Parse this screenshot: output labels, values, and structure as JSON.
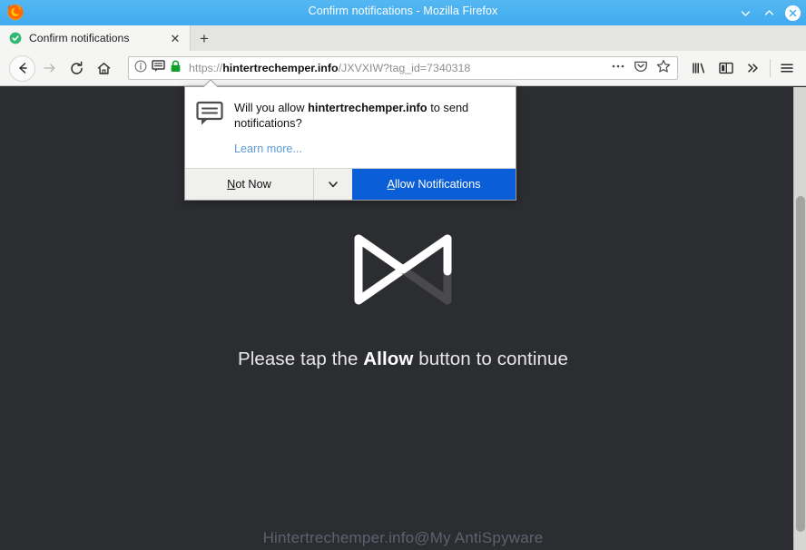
{
  "window": {
    "title": "Confirm notifications - Mozilla Firefox",
    "minimize_label": "⌄",
    "maximize_label": "⌃",
    "close_label": "✕"
  },
  "tabs": {
    "items": [
      {
        "label": "Confirm notifications",
        "favicon": "shield-check-icon",
        "close_label": "✕"
      }
    ],
    "new_tab_label": "+"
  },
  "navbar": {
    "back_icon": "back-arrow-icon",
    "forward_icon": "forward-arrow-icon",
    "reload_icon": "reload-icon",
    "home_icon": "home-icon",
    "url": {
      "scheme": "https://",
      "host": "hintertrechemper.info",
      "path": "/JXVXIW?tag_id=7340318",
      "full": "https://hintertrechemper.info/JXVXIW?tag_id=7340318",
      "identity_icons": [
        "info-circle-icon",
        "notification-bubble-icon",
        "padlock-icon"
      ],
      "action_icons": [
        "page-actions-icon",
        "pocket-icon",
        "bookmark-star-icon"
      ]
    },
    "toolbar_icons": [
      "library-icon",
      "sidebar-icon",
      "overflow-chevron-icon",
      "hamburger-menu-icon"
    ]
  },
  "popup": {
    "icon": "notification-bubble-icon",
    "question_prefix": "Will you allow ",
    "question_host": "hintertrechemper.info",
    "question_suffix": " to send notifications?",
    "learn_more": "Learn more...",
    "not_now_label": "Not Now",
    "not_now_accel": "N",
    "not_now_rest": "ot Now",
    "dropdown_icon": "chevron-down-icon",
    "allow_label": "Allow Notifications",
    "allow_accel": "A",
    "allow_rest": "llow Notifications",
    "allow_bg": "#0a5fd8"
  },
  "page": {
    "logo": "bowtie-logo-icon",
    "headline_prefix": "Please tap the ",
    "headline_emphasis": "Allow",
    "headline_suffix": " button to continue",
    "footer": "Hintertrechemper.info@My AntiSpyware",
    "background": "#2b2d31"
  }
}
